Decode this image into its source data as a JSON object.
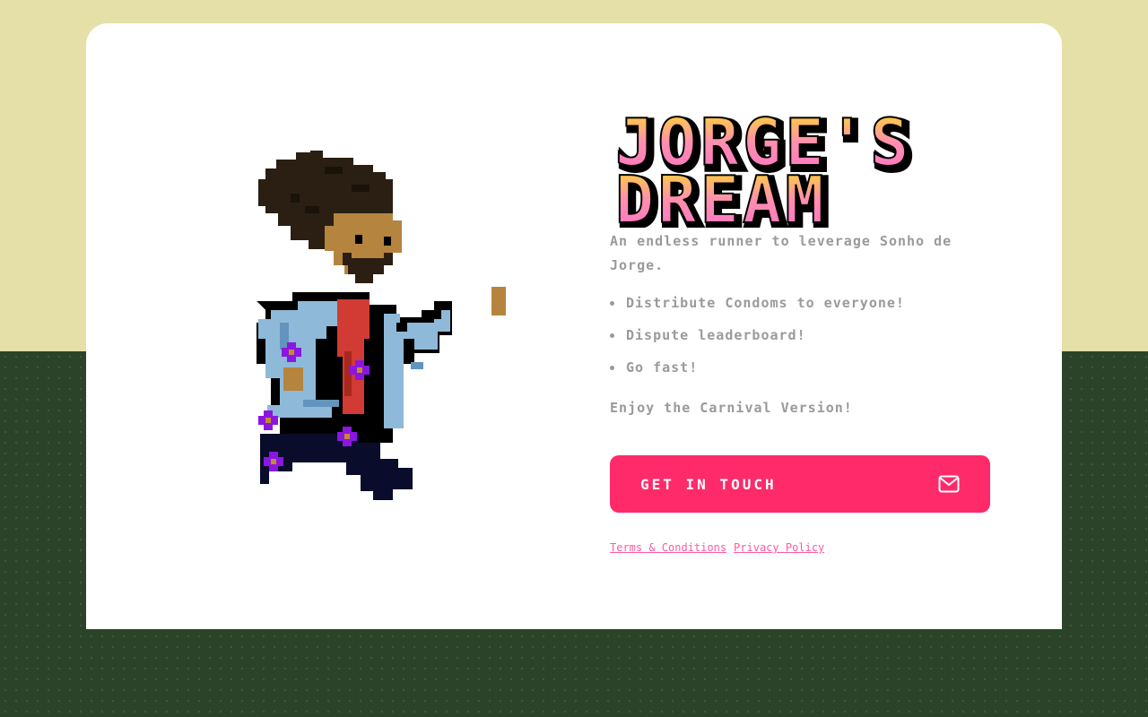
{
  "game": {
    "title_line1": "JORGE'S",
    "title_line2": "DREAM",
    "description": "An endless runner to leverage Sonho de Jorge.",
    "features": [
      "Distribute Condoms to everyone!",
      "Dispute leaderboard!",
      "Go fast!"
    ],
    "enjoy": "Enjoy the Carnival Version!"
  },
  "cta": {
    "label": "GET IN TOUCH",
    "icon": "mail-icon"
  },
  "footer": {
    "terms_label": "Terms & Conditions",
    "privacy_label": "Privacy Policy"
  },
  "colors": {
    "accent": "#ff2a6a",
    "page_top": "#e4e0a8",
    "page_bottom": "#2b4429",
    "title_gradient_top": "#ffe21a",
    "title_gradient_bottom": "#ff6fc8",
    "link": "#ff5aa0",
    "text_muted": "#9a9a9a"
  }
}
